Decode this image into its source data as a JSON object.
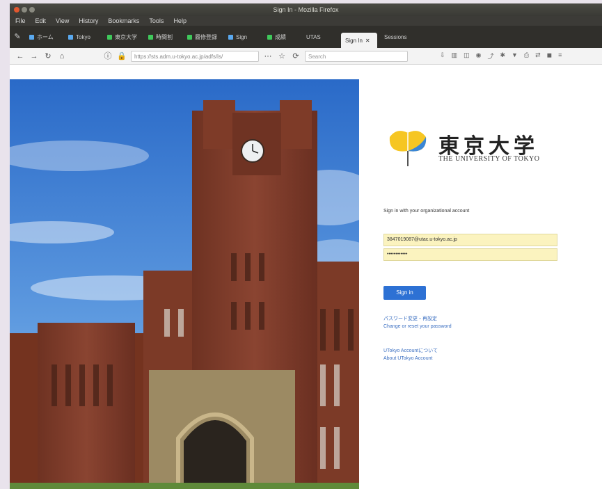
{
  "window": {
    "title": "Sign In - Mozilla Firefox"
  },
  "menu": [
    "File",
    "Edit",
    "View",
    "History",
    "Bookmarks",
    "Tools",
    "Help"
  ],
  "tabs": [
    {
      "label": "ホーム"
    },
    {
      "label": "Tokyo"
    },
    {
      "label": "東京大学"
    },
    {
      "label": "時間割"
    },
    {
      "label": "履修登録"
    },
    {
      "label": "Sign"
    },
    {
      "label": "成績"
    },
    {
      "label": "UTAS"
    },
    {
      "label": "Sign In",
      "close": "✕"
    },
    {
      "label": "Sessions"
    }
  ],
  "nav": {
    "url": "https://sts.adm.u-tokyo.ac.jp/adfs/ls/",
    "search_placeholder": "Search"
  },
  "login": {
    "logo_name": "東京大学",
    "logo_sub": "THE UNIVERSITY OF TOKYO",
    "prompt": "Sign in with your organizational account",
    "username": "3847019087@utac.u-tokyo.ac.jp",
    "password": "••••••••••••",
    "signin_label": "Sign in",
    "link1_ja": "パスワード変更・再設定",
    "link1_en": "Change or reset your password",
    "link2_ja": "UTokyo Accountについて",
    "link2_en": "About UTokyo Account"
  },
  "colors": {
    "accent": "#2d71d4",
    "autofill": "#fbf3bf",
    "brick": "#7d3a27"
  }
}
